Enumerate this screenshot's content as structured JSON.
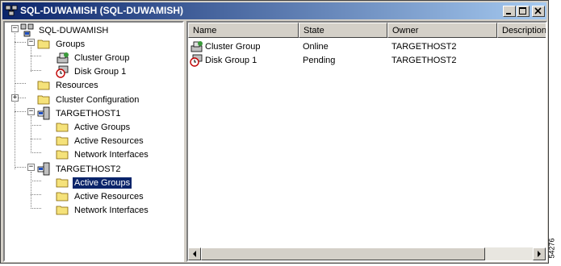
{
  "window": {
    "title": "SQL-DUWAMISH (SQL-DUWAMISH)"
  },
  "tree": {
    "root": "SQL-DUWAMISH",
    "groups": "Groups",
    "cluster_group": "Cluster Group",
    "disk_group": "Disk Group 1",
    "resources": "Resources",
    "cluster_configuration": "Cluster Configuration",
    "host1": "TARGETHOST1",
    "host1_active_groups": "Active Groups",
    "host1_active_resources": "Active Resources",
    "host1_network_interfaces": "Network Interfaces",
    "host2": "TARGETHOST2",
    "host2_active_groups": "Active Groups",
    "host2_active_resources": "Active Resources",
    "host2_network_interfaces": "Network Interfaces"
  },
  "list": {
    "columns": {
      "name": "Name",
      "state": "State",
      "owner": "Owner",
      "description": "Description"
    },
    "rows": [
      {
        "name": "Cluster Group",
        "state": "Online",
        "owner": "TARGETHOST2",
        "icon": "group-online-icon"
      },
      {
        "name": "Disk Group 1",
        "state": "Pending",
        "owner": "TARGETHOST2",
        "icon": "group-pending-icon"
      }
    ]
  },
  "figure_id": "54276",
  "colors": {
    "titlebar_start": "#0a246a",
    "titlebar_end": "#a6caf0",
    "selection": "#0a246a",
    "folder": "#f5e27a"
  }
}
